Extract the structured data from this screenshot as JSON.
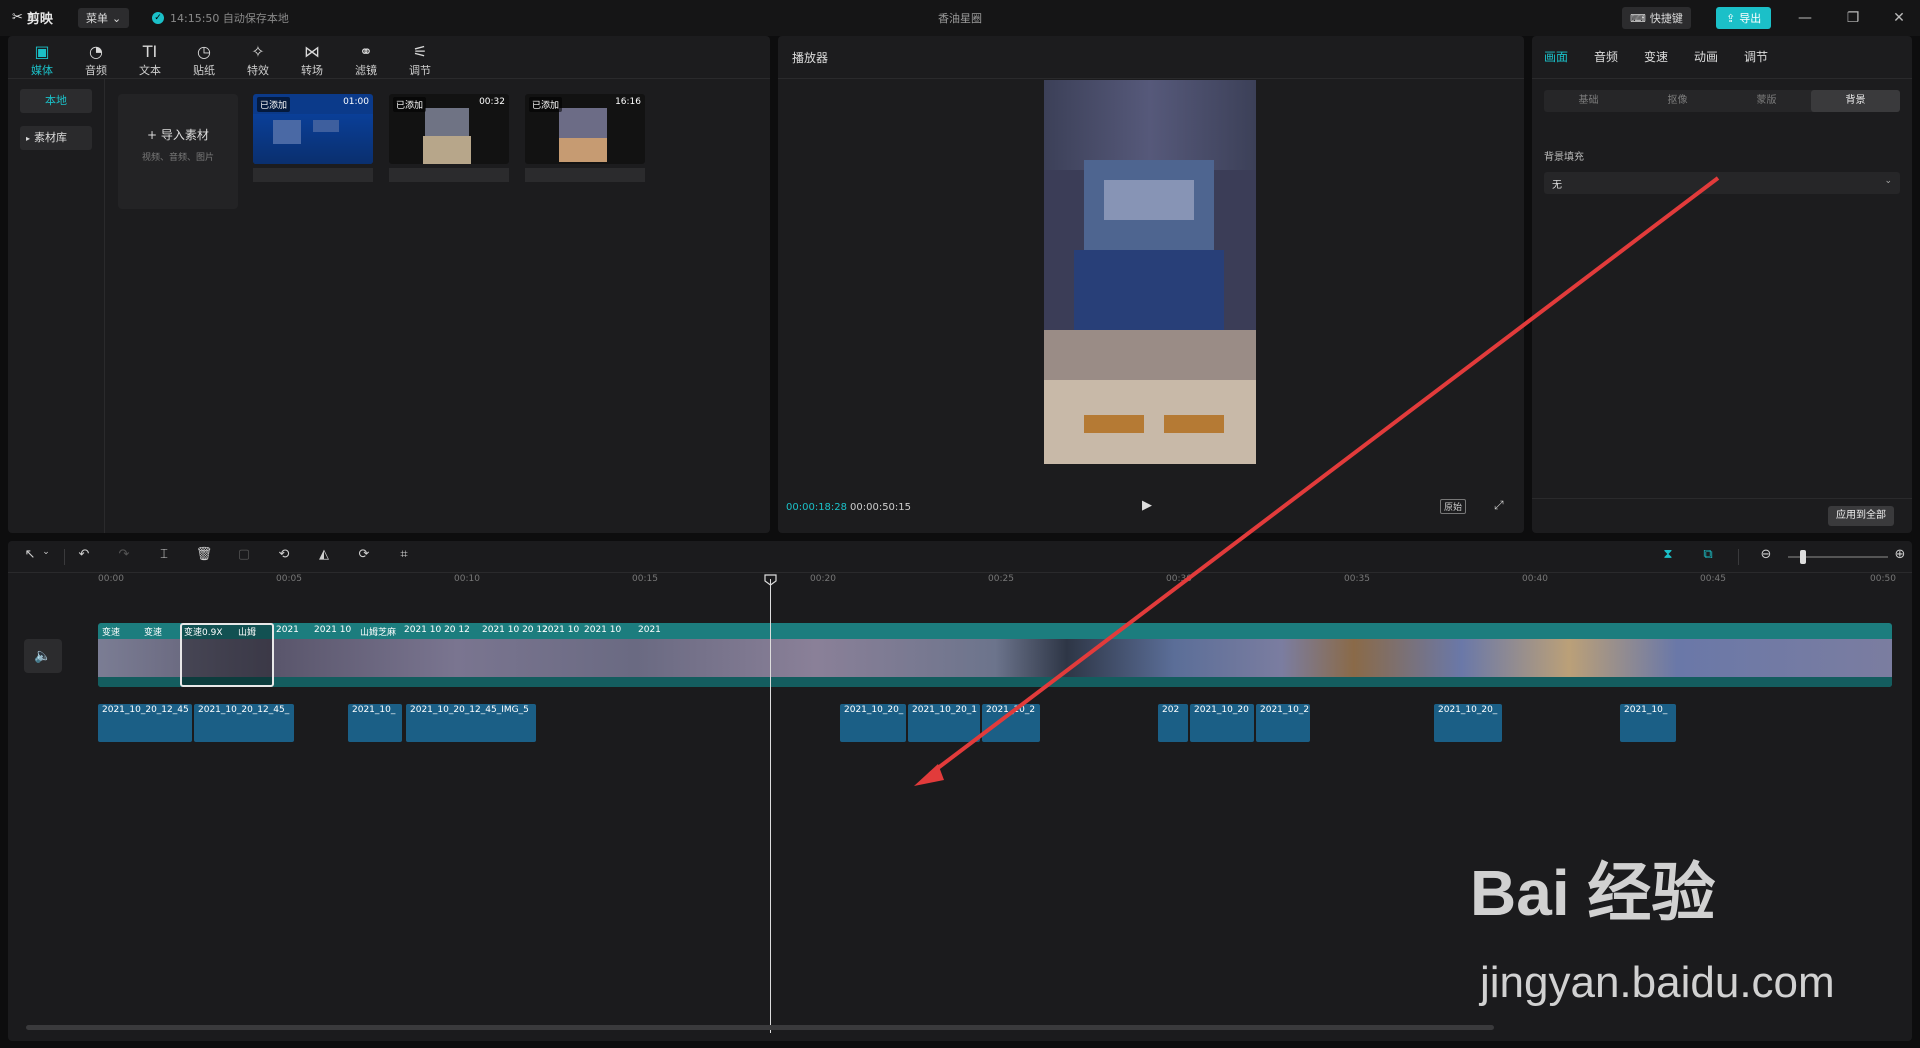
{
  "app": {
    "logo": "剪映",
    "menu_label": "菜单",
    "autosave": "14:15:50 自动保存本地",
    "window_title": "香油星圈",
    "shortcut_label": "快捷键",
    "export_label": "导出"
  },
  "media": {
    "tools": [
      "媒体",
      "音频",
      "文本",
      "贴纸",
      "特效",
      "转场",
      "滤镜",
      "调节"
    ],
    "active_tool": "媒体",
    "side_local": "本地",
    "side_library": "素材库",
    "import_label": "导入素材",
    "import_hint": "视频、音频、图片",
    "thumbs": [
      {
        "tag": "已添加",
        "duration": "01:00"
      },
      {
        "tag": "已添加",
        "duration": "00:32"
      },
      {
        "tag": "已添加",
        "duration": "16:16"
      }
    ]
  },
  "player": {
    "title": "播放器",
    "current_time": "00:00:18:28",
    "total_time": "00:00:50:15",
    "original_label": "原始"
  },
  "props": {
    "tabs": [
      "画面",
      "音频",
      "变速",
      "动画",
      "调节"
    ],
    "active_tab": "画面",
    "subtabs": [
      "基础",
      "抠像",
      "蒙版",
      "背景"
    ],
    "active_subtab": "背景",
    "bg_fill_label": "背景填充",
    "bg_fill_value": "无",
    "apply_all_label": "应用到全部"
  },
  "timeline": {
    "ruler": [
      "00:00",
      "00:05",
      "00:10",
      "00:15",
      "00:20",
      "00:25",
      "00:30",
      "00:35",
      "00:40",
      "00:45",
      "00:50"
    ],
    "main_clip_labels": [
      "变速",
      "变速",
      "变速0.9X",
      "山姆",
      "2021",
      "2021 10",
      "山姆芝麻",
      "2021 10 20 12",
      "2021 10 20 12",
      "2021 10",
      "2021 10",
      "2021"
    ],
    "audio_clips": [
      "2021_10_20_12_45",
      "2021_10_20_12_45_",
      "2021_10_",
      "2021_10_20_12_45_IMG_5",
      "2021_10_20_",
      "2021_10_20_1",
      "2021_10_2",
      "202",
      "2021_10_20",
      "2021_10_2",
      "2021_10_20_",
      "2021_10_"
    ]
  },
  "watermark": {
    "brand": "Bai 经验",
    "url": "jingyan.baidu.com"
  },
  "colors": {
    "accent": "#1bc0c8",
    "clip": "#1c7d7e",
    "audio": "#1b5f86",
    "arrow": "#e23b3b"
  }
}
